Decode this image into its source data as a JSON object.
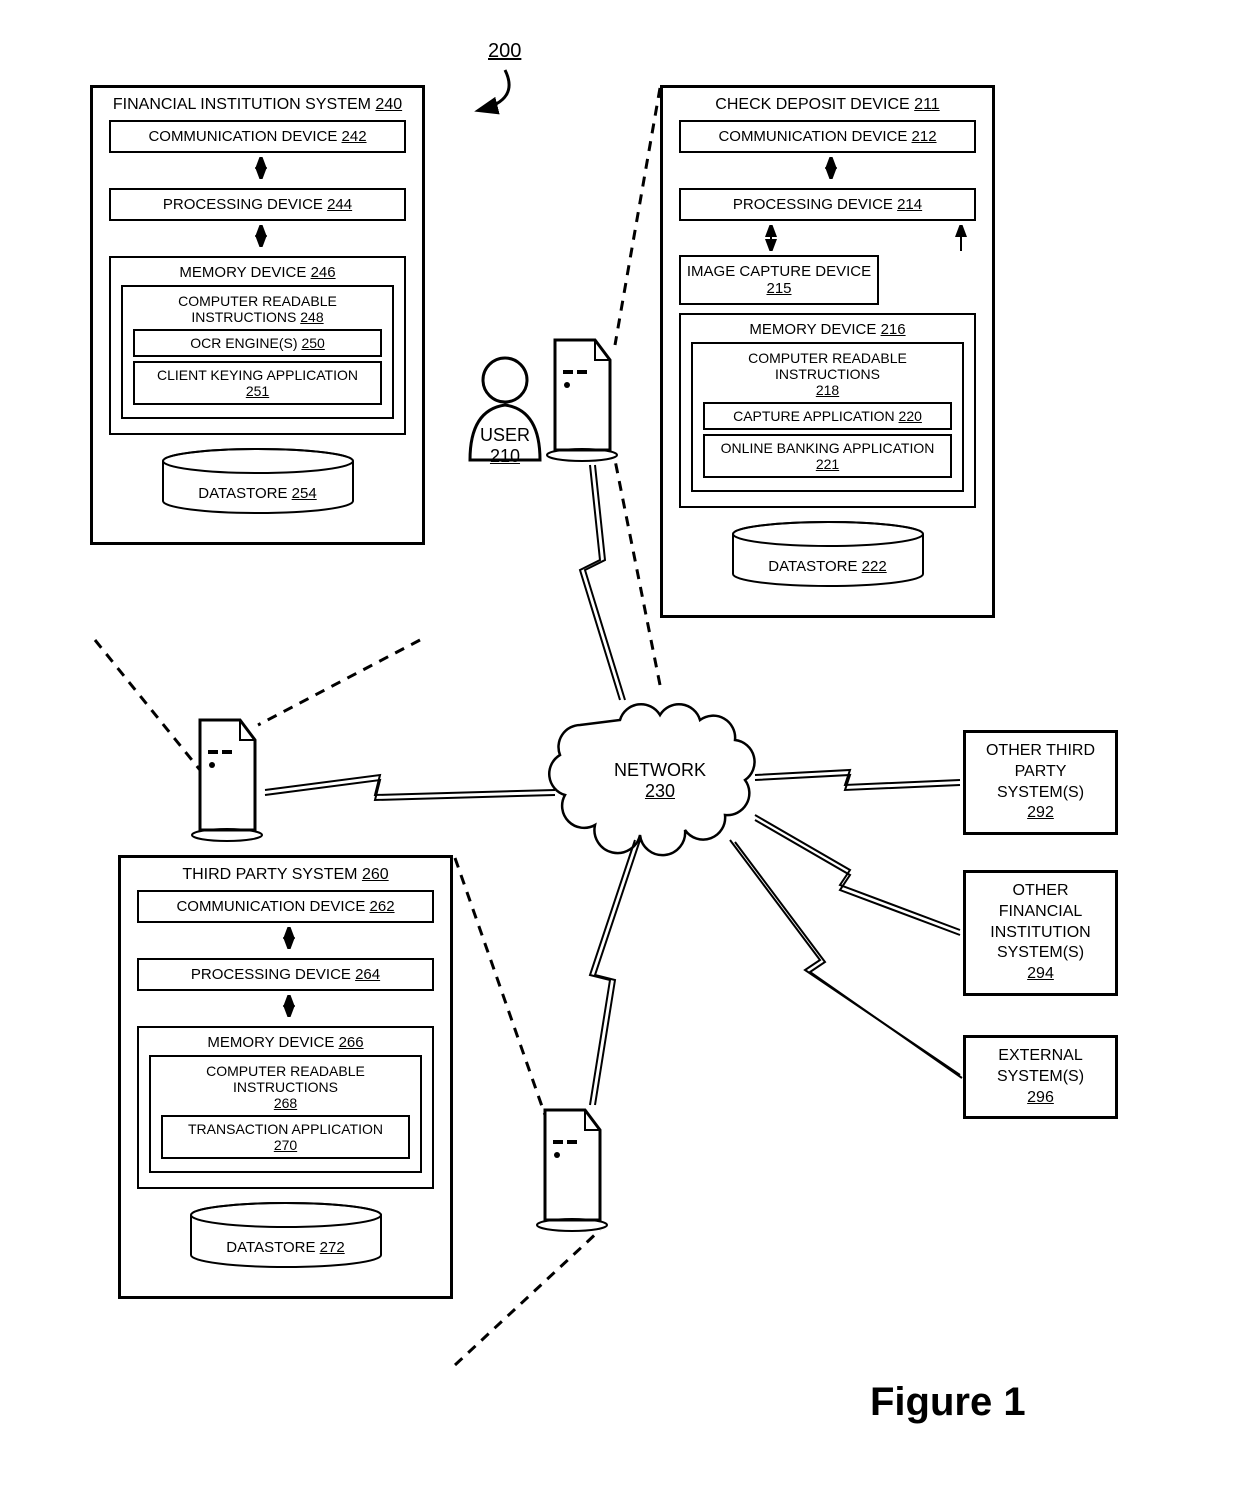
{
  "figure_ref": "200",
  "figure_label": "Figure 1",
  "user": {
    "label": "USER",
    "ref": "210"
  },
  "network": {
    "label": "NETWORK",
    "ref": "230"
  },
  "fin": {
    "title": "FINANCIAL INSTITUTION SYSTEM",
    "ref": "240",
    "comm": "COMMUNICATION DEVICE",
    "comm_ref": "242",
    "proc": "PROCESSING DEVICE",
    "proc_ref": "244",
    "mem": "MEMORY DEVICE",
    "mem_ref": "246",
    "cri": "COMPUTER READABLE INSTRUCTIONS",
    "cri_ref": "248",
    "ocr": "OCR ENGINE(S)",
    "ocr_ref": "250",
    "cka": "CLIENT KEYING APPLICATION",
    "cka_ref": "251",
    "ds": "DATASTORE",
    "ds_ref": "254"
  },
  "cdd": {
    "title": "CHECK DEPOSIT DEVICE",
    "ref": "211",
    "comm": "COMMUNICATION DEVICE",
    "comm_ref": "212",
    "proc": "PROCESSING DEVICE",
    "proc_ref": "214",
    "img": "IMAGE CAPTURE DEVICE",
    "img_ref": "215",
    "mem": "MEMORY DEVICE",
    "mem_ref": "216",
    "cri": "COMPUTER READABLE INSTRUCTIONS",
    "cri_ref": "218",
    "cap": "CAPTURE APPLICATION",
    "cap_ref": "220",
    "oba": "ONLINE BANKING APPLICATION",
    "oba_ref": "221",
    "ds": "DATASTORE",
    "ds_ref": "222"
  },
  "tps": {
    "title": "THIRD PARTY SYSTEM",
    "ref": "260",
    "comm": "COMMUNICATION DEVICE",
    "comm_ref": "262",
    "proc": "PROCESSING DEVICE",
    "proc_ref": "264",
    "mem": "MEMORY DEVICE",
    "mem_ref": "266",
    "cri": "COMPUTER READABLE INSTRUCTIONS",
    "cri_ref": "268",
    "ta": "TRANSACTION APPLICATION",
    "ta_ref": "270",
    "ds": "DATASTORE",
    "ds_ref": "272"
  },
  "ext": {
    "otps": "OTHER THIRD PARTY SYSTEM(S)",
    "otps_ref": "292",
    "ofis": "OTHER FINANCIAL INSTITUTION SYSTEM(S)",
    "ofis_ref": "294",
    "ext": "EXTERNAL SYSTEM(S)",
    "ext_ref": "296"
  }
}
